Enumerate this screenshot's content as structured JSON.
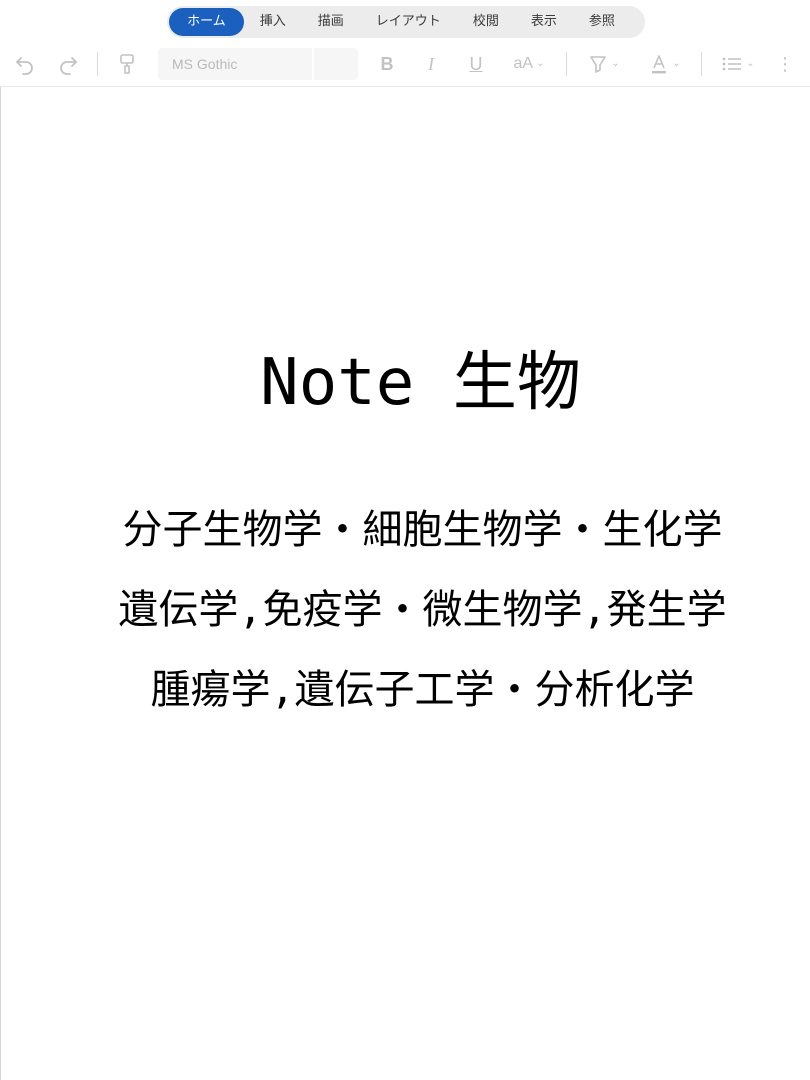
{
  "tabs": [
    {
      "label": "ホーム",
      "active": true
    },
    {
      "label": "挿入",
      "active": false
    },
    {
      "label": "描画",
      "active": false
    },
    {
      "label": "レイアウト",
      "active": false
    },
    {
      "label": "校閲",
      "active": false
    },
    {
      "label": "表示",
      "active": false
    },
    {
      "label": "参照",
      "active": false
    }
  ],
  "toolbar": {
    "font_name": "MS Gothic",
    "bold_glyph": "B",
    "italic_glyph": "I",
    "underline_glyph": "U",
    "font_size_glyph": "aA",
    "more_glyph": "⋮",
    "icons": [
      "undo-icon",
      "redo-icon",
      "format-painter-icon",
      "bold-icon",
      "italic-icon",
      "underline-icon",
      "font-size-icon",
      "highlight-icon",
      "font-color-icon",
      "bullet-list-icon",
      "more-icon"
    ]
  },
  "colors": {
    "accent": "#1b5fbf",
    "tab_bar": "#ececec",
    "disabled_icon": "#c2c2c2",
    "text": "#000000"
  },
  "document": {
    "title": "Note 生物",
    "lines": [
      "分子生物学・細胞生物学・生化学",
      "遺伝学,免疫学・微生物学,発生学",
      "腫瘍学,遺伝子工学・分析化学"
    ]
  }
}
